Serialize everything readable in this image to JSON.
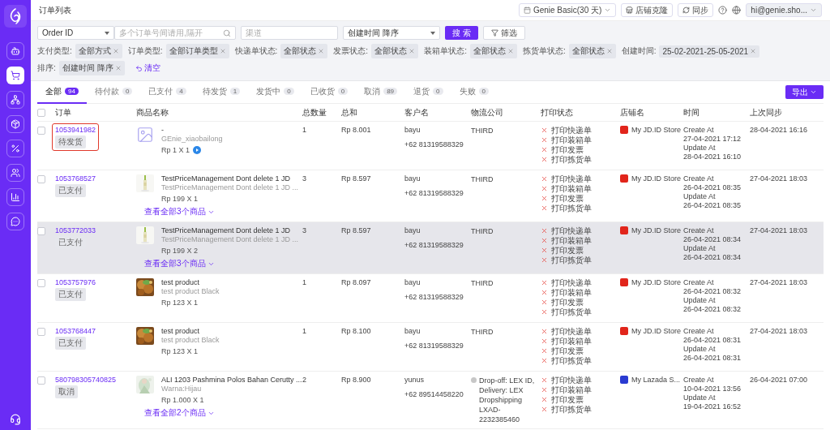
{
  "page_title": "订单列表",
  "topbar": {
    "plan": "Genie Basic(30 天)",
    "clone_button": "店铺克隆",
    "sync_button": "同步",
    "user": "hi@genie.sho..."
  },
  "sidebar": {
    "items": [
      {
        "selected": false
      },
      {
        "selected": true
      },
      {
        "selected": false
      },
      {
        "selected": false
      },
      {
        "selected": false
      },
      {
        "selected": false
      },
      {
        "selected": false
      },
      {
        "selected": false
      }
    ]
  },
  "search": {
    "field_select": "Order ID",
    "order_placeholder": "多个订单号间请用,隔开",
    "channel_placeholder": "渠道",
    "sort_select": "创建时间 降序",
    "search_button": "搜 索",
    "filter_button": "筛选"
  },
  "filters": [
    {
      "label": "支付类型:",
      "value": "全部方式"
    },
    {
      "label": "订单类型:",
      "value": "全部订单类型"
    },
    {
      "label": "快递单状态:",
      "value": "全部状态"
    },
    {
      "label": "发票状态:",
      "value": "全部状态"
    },
    {
      "label": "装箱单状态:",
      "value": "全部状态"
    },
    {
      "label": "拣货单状态:",
      "value": "全部状态"
    },
    {
      "label": "创建时间:",
      "value": "25-02-2021-25-05-2021"
    },
    {
      "label": "排序:",
      "value": "创建时间 降序"
    }
  ],
  "clear_link": "清空",
  "tabs": [
    {
      "label": "全部",
      "count": "94",
      "selected": true
    },
    {
      "label": "待付款",
      "count": "0",
      "selected": false
    },
    {
      "label": "已支付",
      "count": "4",
      "selected": false
    },
    {
      "label": "待发货",
      "count": "1",
      "selected": false
    },
    {
      "label": "发货中",
      "count": "0",
      "selected": false
    },
    {
      "label": "已收货",
      "count": "0",
      "selected": false
    },
    {
      "label": "取消",
      "count": "89",
      "selected": false
    },
    {
      "label": "退货",
      "count": "0",
      "selected": false
    },
    {
      "label": "失败",
      "count": "0",
      "selected": false
    }
  ],
  "export_button": "导出",
  "table": {
    "select_all_checked": false,
    "columns": [
      "订单",
      "商品名称",
      "总数量",
      "总和",
      "客户名",
      "物流公司",
      "打印状态",
      "店铺名",
      "时间",
      "上次同步"
    ],
    "rows": [
      {
        "checked": false,
        "hovered": false,
        "highlighted": true,
        "order_id": "1053941982",
        "status": "待发货",
        "thumb": {
          "kind": "placeholder"
        },
        "product": "-",
        "variant": "GEnie_xiaobailong",
        "price": "Rp 1 X 1",
        "badge": true,
        "quantity": "1",
        "total": "Rp 8.001",
        "customer": "bayu",
        "phone": "+62 81319588329",
        "logistics": {
          "text": "THIRD",
          "dot": false
        },
        "print": [
          {
            "label": "打印快递单",
            "done": false
          },
          {
            "label": "打印装箱单",
            "done": false
          },
          {
            "label": "打印发票",
            "done": false
          },
          {
            "label": "打印拣货单",
            "done": false
          }
        ],
        "store": {
          "name": "My JD.ID Store",
          "color": "#e1251b"
        },
        "create_label": "Create At",
        "create_time": "27-04-2021 17:12",
        "update_label": "Update At",
        "update_time": "28-04-2021 16:10",
        "last_sync": "28-04-2021 16:16"
      },
      {
        "checked": false,
        "hovered": false,
        "highlighted": false,
        "order_id": "1053768527",
        "status": "已支付",
        "product": "TestPriceManagement Dont delete 1 JD",
        "variant": "TestPriceManagement Dont delete 1 JD ...",
        "price": "Rp 199 X 1",
        "badge": false,
        "more": "查看全部3个商品",
        "quantity": "3",
        "total": "Rp 8.597",
        "customer": "bayu",
        "phone": "+62 81319588329",
        "logistics": {
          "text": "THIRD",
          "dot": false
        },
        "print": [
          {
            "label": "打印快递单",
            "done": false
          },
          {
            "label": "打印装箱单",
            "done": false
          },
          {
            "label": "打印发票",
            "done": false
          },
          {
            "label": "打印拣货单",
            "done": false
          }
        ],
        "store": {
          "name": "My JD.ID Store",
          "color": "#e1251b"
        },
        "create_label": "Create At",
        "create_time": "26-04-2021 08:35",
        "update_label": "Update At",
        "update_time": "26-04-2021 08:35",
        "last_sync": "27-04-2021 18:03"
      },
      {
        "checked": false,
        "hovered": true,
        "highlighted": false,
        "order_id": "1053772033",
        "status": "已支付",
        "product": "TestPriceManagement Dont delete 1 JD",
        "variant": "TestPriceManagement Dont delete 1 JD ...",
        "price": "Rp 199 X 2",
        "badge": false,
        "more": "查看全部3个商品",
        "quantity": "3",
        "total": "Rp 8.597",
        "customer": "bayu",
        "phone": "+62 81319588329",
        "logistics": {
          "text": "THIRD",
          "dot": false
        },
        "print": [
          {
            "label": "打印快递单",
            "done": false
          },
          {
            "label": "打印装箱单",
            "done": false
          },
          {
            "label": "打印发票",
            "done": false
          },
          {
            "label": "打印拣货单",
            "done": false
          }
        ],
        "store": {
          "name": "My JD.ID Store",
          "color": "#e1251b"
        },
        "create_label": "Create At",
        "create_time": "26-04-2021 08:34",
        "update_label": "Update At",
        "update_time": "26-04-2021 08:34",
        "last_sync": "27-04-2021 18:03"
      },
      {
        "checked": false,
        "hovered": false,
        "highlighted": false,
        "order_id": "1053757976",
        "status": "已支付",
        "product": "test product",
        "variant": "test product Black",
        "price": "Rp 123 X 1",
        "badge": false,
        "quantity": "1",
        "total": "Rp 8.097",
        "customer": "bayu",
        "phone": "+62 81319588329",
        "logistics": {
          "text": "THIRD",
          "dot": false
        },
        "print": [
          {
            "label": "打印快递单",
            "done": false
          },
          {
            "label": "打印装箱单",
            "done": false
          },
          {
            "label": "打印发票",
            "done": false
          },
          {
            "label": "打印拣货单",
            "done": false
          }
        ],
        "store": {
          "name": "My JD.ID Store",
          "color": "#e1251b"
        },
        "create_label": "Create At",
        "create_time": "26-04-2021 08:32",
        "update_label": "Update At",
        "update_time": "26-04-2021 08:32",
        "last_sync": "27-04-2021 18:03"
      },
      {
        "checked": false,
        "hovered": false,
        "highlighted": false,
        "order_id": "1053768447",
        "status": "已支付",
        "product": "test product",
        "variant": "test product Black",
        "price": "Rp 123 X 1",
        "badge": false,
        "quantity": "1",
        "total": "Rp 8.100",
        "customer": "bayu",
        "phone": "+62 81319588329",
        "logistics": {
          "text": "THIRD",
          "dot": false
        },
        "print": [
          {
            "label": "打印快递单",
            "done": false
          },
          {
            "label": "打印装箱单",
            "done": false
          },
          {
            "label": "打印发票",
            "done": false
          },
          {
            "label": "打印拣货单",
            "done": false
          }
        ],
        "store": {
          "name": "My JD.ID Store",
          "color": "#e1251b"
        },
        "create_label": "Create At",
        "create_time": "26-04-2021 08:31",
        "update_label": "Update At",
        "update_time": "26-04-2021 08:31",
        "last_sync": "27-04-2021 18:03"
      },
      {
        "checked": false,
        "hovered": false,
        "highlighted": false,
        "order_id": "580798305740825",
        "status": "取消",
        "product": "ALI 1203 Pashmina Polos Bahan Cerutty ...",
        "variant": "Warna:Hijau",
        "price": "Rp 1.000 X 1",
        "badge": false,
        "more": "查看全部2个商品",
        "quantity": "2",
        "total": "Rp 8.900",
        "customer": "yunus",
        "phone": "+62 89514458220",
        "logistics": {
          "text": "Drop-off: LEX ID, Delivery: LEX Dropshipping LXAD-2232385460",
          "dot": true
        },
        "print": [
          {
            "label": "打印快递单",
            "done": false
          },
          {
            "label": "打印装箱单",
            "done": false
          },
          {
            "label": "打印发票",
            "done": false
          },
          {
            "label": "打印拣货单",
            "done": false
          }
        ],
        "store": {
          "name": "My Lazada S...",
          "color": "#2a3bd1"
        },
        "create_label": "Create At",
        "create_time": "10-04-2021 13:56",
        "update_label": "Update At",
        "update_time": "19-04-2021 16:52",
        "last_sync": "26-04-2021 07:00"
      }
    ]
  }
}
